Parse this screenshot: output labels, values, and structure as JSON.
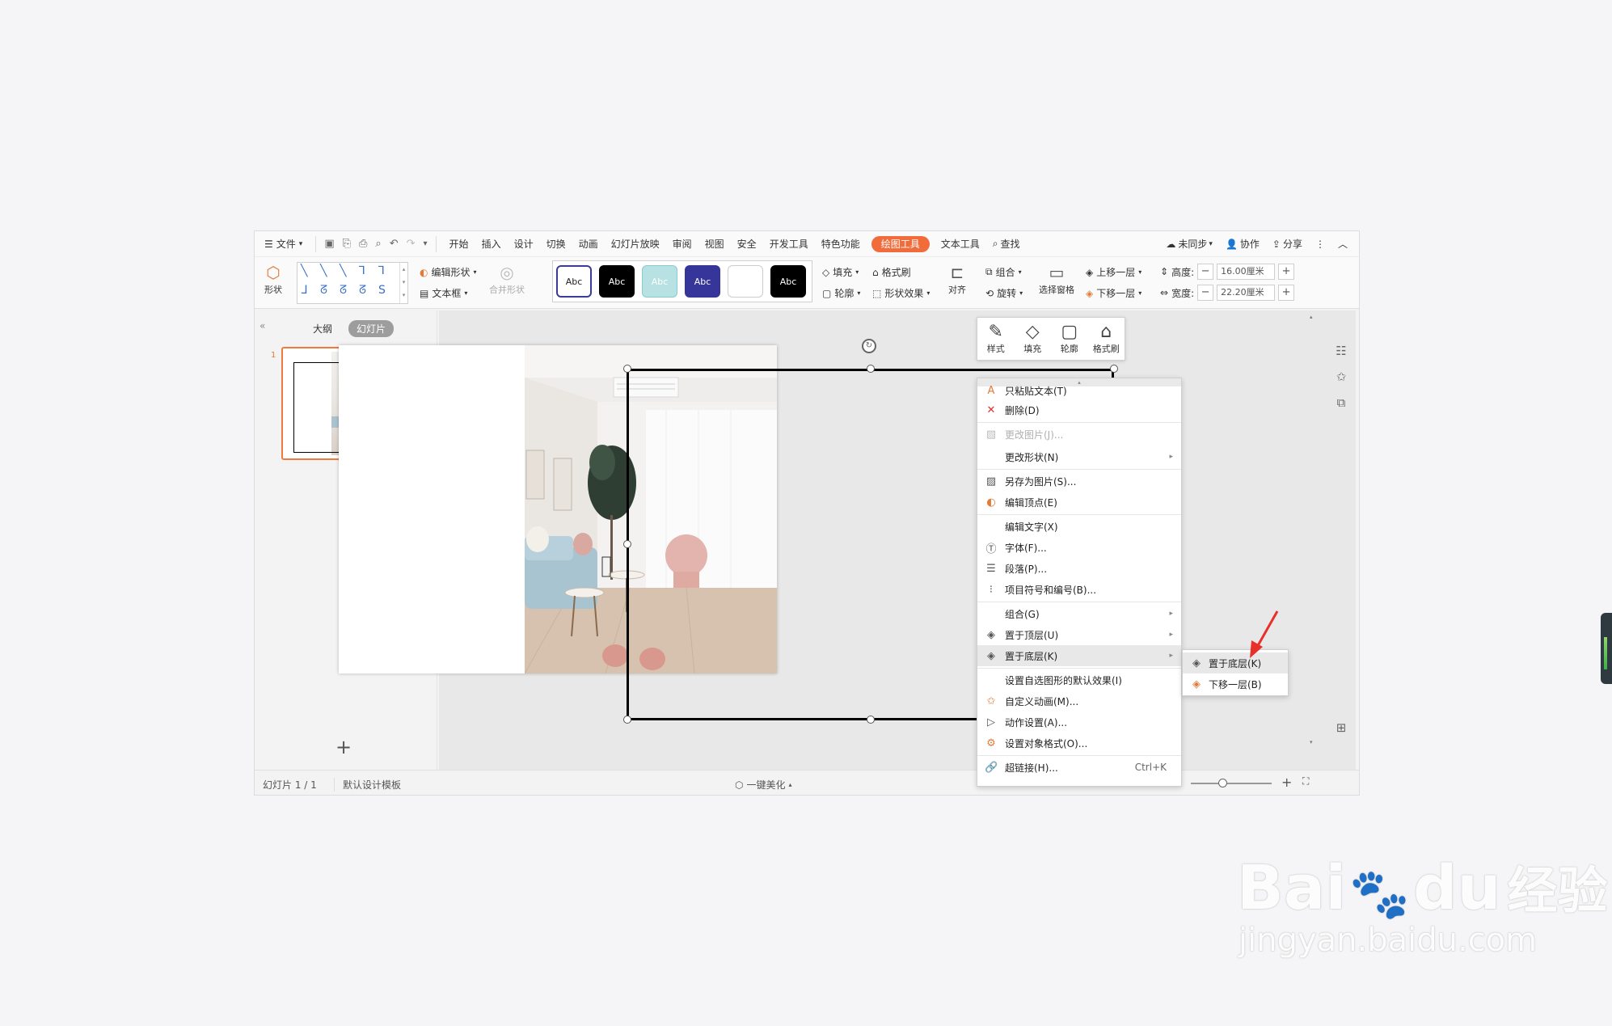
{
  "menubar": {
    "file": "文件",
    "tabs": [
      "开始",
      "插入",
      "设计",
      "切换",
      "动画",
      "幻灯片放映",
      "审阅",
      "视图",
      "安全",
      "开发工具",
      "特色功能",
      "绘图工具",
      "文本工具"
    ],
    "active_tab": "绘图工具",
    "search": "查找",
    "sync": "未同步",
    "collab": "协作",
    "share": "分享"
  },
  "ribbon": {
    "shape": "形状",
    "edit_shape": "编辑形状",
    "text_box": "文本框",
    "merge_shape": "合并形状",
    "style_sample": "Abc",
    "fill": "填充",
    "format_painter": "格式刷",
    "outline": "轮廓",
    "shape_effect": "形状效果",
    "align": "对齐",
    "group": "组合",
    "rotate": "旋转",
    "selection_pane": "选择窗格",
    "bring_forward": "上移一层",
    "send_backward": "下移一层",
    "height_label": "高度:",
    "height_value": "16.00厘米",
    "width_label": "宽度:",
    "width_value": "22.20厘米"
  },
  "left_panel": {
    "outline_tab": "大纲",
    "slides_tab": "幻灯片",
    "slide_number": "1"
  },
  "statusbar": {
    "slide_info": "幻灯片 1 / 1",
    "template": "默认设计模板",
    "beautify": "一键美化"
  },
  "mini_toolbar": [
    "样式",
    "填充",
    "轮廓",
    "格式刷"
  ],
  "context_menu": {
    "items": [
      {
        "label": "只粘贴文本(T)",
        "disabled": false
      },
      {
        "label": "删除(D)",
        "disabled": false
      },
      {
        "label": "更改图片(J)...",
        "disabled": true
      },
      {
        "label": "更改形状(N)",
        "disabled": false
      },
      {
        "label": "另存为图片(S)...",
        "disabled": false
      },
      {
        "label": "编辑顶点(E)",
        "disabled": false
      },
      {
        "label": "编辑文字(X)",
        "disabled": false
      },
      {
        "label": "字体(F)...",
        "disabled": false
      },
      {
        "label": "段落(P)...",
        "disabled": false
      },
      {
        "label": "项目符号和编号(B)...",
        "disabled": false
      },
      {
        "label": "组合(G)",
        "disabled": false
      },
      {
        "label": "置于顶层(U)",
        "disabled": false
      },
      {
        "label": "置于底层(K)",
        "disabled": false
      },
      {
        "label": "设置自选图形的默认效果(I)",
        "disabled": false
      },
      {
        "label": "自定义动画(M)...",
        "disabled": false
      },
      {
        "label": "动作设置(A)...",
        "disabled": false
      },
      {
        "label": "设置对象格式(O)...",
        "disabled": false
      },
      {
        "label": "超链接(H)...",
        "disabled": false
      }
    ],
    "hyperlink_shortcut": "Ctrl+K"
  },
  "submenu": {
    "items": [
      "置于底层(K)",
      "下移一层(B)"
    ]
  },
  "watermark": {
    "brand": "Bai",
    "brand2": "du",
    "cn": "经验",
    "url": "jingyan.baidu.com"
  },
  "colors": {
    "accent": "#f26b3a",
    "red_arrow": "#e8302a"
  }
}
